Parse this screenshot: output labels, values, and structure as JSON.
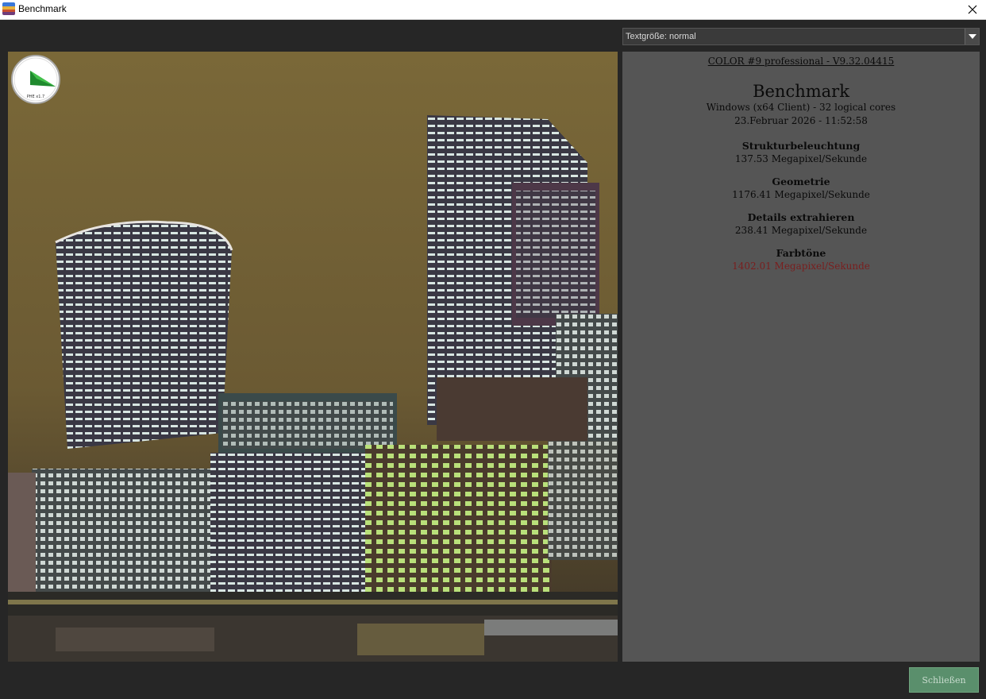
{
  "window": {
    "title": "Benchmark",
    "icon": "app-palette-icon"
  },
  "controls": {
    "text_size_select": {
      "value": "Textgröße: normal"
    },
    "close_button_label": "Schließen"
  },
  "gauge": {
    "label": "PHE x1.7",
    "icon": "benchmark-gauge-icon"
  },
  "info": {
    "version": "COLOR #9 professional - V9.32.04415",
    "title": "Benchmark",
    "system": "Windows (x64 Client) - 32 logical cores",
    "datetime": "23.Februar 2026 - 11:52:58",
    "metrics": [
      {
        "name": "Strukturbeleuchtung",
        "value": "137.53 Megapixel/Sekunde"
      },
      {
        "name": "Geometrie",
        "value": "1176.41 Megapixel/Sekunde"
      },
      {
        "name": "Details extrahieren",
        "value": "238.41 Megapixel/Sekunde"
      },
      {
        "name": "Farbtöne",
        "value": "1402.01 Megapixel/Sekunde"
      }
    ]
  },
  "colors": {
    "highlight_value": "#7a1e1e",
    "close_button_bg": "#5a8f6c",
    "panel_bg": "#555555"
  }
}
